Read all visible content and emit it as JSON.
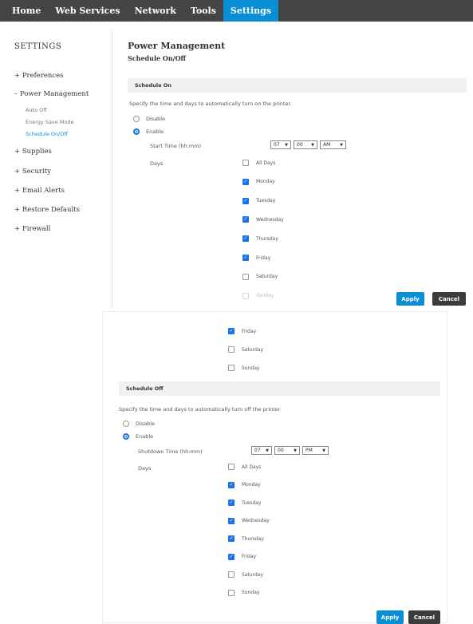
{
  "nav": {
    "items": [
      "Home",
      "Web Services",
      "Network",
      "Tools",
      "Settings"
    ],
    "active": "Settings"
  },
  "sidebar": {
    "title": "SETTINGS",
    "items": {
      "preferences": "+ Preferences",
      "power_management": "– Power Management",
      "auto_off": "Auto Off",
      "energy_save": "Energy Save Mode",
      "schedule": "Schedule On/Off",
      "supplies": "+ Supplies",
      "security": "+ Security",
      "email_alerts": "+ Email Alerts",
      "restore_defaults": "+ Restore Defaults",
      "firewall": "+ Firewall"
    }
  },
  "page": {
    "title": "Power Management",
    "subtitle": "Schedule On/Off"
  },
  "schedule_on": {
    "header": "Schedule On",
    "description": "Specify the time and days to automatically turn on the printer.",
    "disable_label": "Disable",
    "enable_label": "Enable",
    "time_label": "Start Time (hh:mm)",
    "hour": "07",
    "minute": "00",
    "ampm": "AM",
    "days_label": "Days",
    "days": [
      {
        "label": "All Days",
        "checked": false
      },
      {
        "label": "Monday",
        "checked": true
      },
      {
        "label": "Tuesday",
        "checked": true
      },
      {
        "label": "Wednesday",
        "checked": true
      },
      {
        "label": "Thursday",
        "checked": true
      },
      {
        "label": "Friday",
        "checked": true
      },
      {
        "label": "Saturday",
        "checked": false
      },
      {
        "label": "Sunday",
        "checked": false
      }
    ]
  },
  "schedule_off": {
    "header": "Schedule Off",
    "description": "Specify the time and days to automatically turn off the printer.",
    "disable_label": "Disable",
    "enable_label": "Enable",
    "time_label": "Shutdown Time (hh:mm)",
    "hour": "07",
    "minute": "00",
    "ampm": "PM",
    "days_label": "Days",
    "days": [
      {
        "label": "All Days",
        "checked": false
      },
      {
        "label": "Monday",
        "checked": true
      },
      {
        "label": "Tuesday",
        "checked": true
      },
      {
        "label": "Wednesday",
        "checked": true
      },
      {
        "label": "Thursday",
        "checked": true
      },
      {
        "label": "Friday",
        "checked": true
      },
      {
        "label": "Saturday",
        "checked": false
      },
      {
        "label": "Sunday",
        "checked": false
      }
    ]
  },
  "panel2_top_days": [
    {
      "label": "Friday",
      "checked": true
    },
    {
      "label": "Saturday",
      "checked": false
    },
    {
      "label": "Sunday",
      "checked": false
    }
  ],
  "buttons": {
    "apply": "Apply",
    "cancel": "Cancel"
  },
  "colors": {
    "nav_bg": "#444444",
    "nav_active": "#0a8fd6",
    "accent": "#1a73e8",
    "apply_bg": "#0a8fd6",
    "cancel_bg": "#3c3c3c"
  }
}
